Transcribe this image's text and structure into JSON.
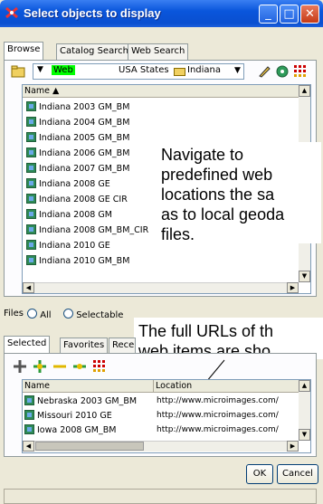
{
  "window": {
    "title": "Select objects to display"
  },
  "tabs_top": [
    "Browse",
    "Catalog Search",
    "Web Search"
  ],
  "location_bar": {
    "web_label": "Web",
    "country": "USA States",
    "state": "Indiana"
  },
  "list_header": "Name ▲",
  "browse_items": [
    "Indiana 2003 GM_BM",
    "Indiana 2004 GM_BM",
    "Indiana 2005 GM_BM",
    "Indiana 2006 GM_BM",
    "Indiana 2007 GM_BM",
    "Indiana 2008 GE",
    "Indiana 2008 GE CIR",
    "Indiana 2008 GM",
    "Indiana 2008 GM_BM_CIR",
    "Indiana 2010 GE",
    "Indiana 2010 GM_BM"
  ],
  "annotation1": [
    "Navigate to",
    "predefined web",
    "locations the sa",
    "as to local geoda",
    "files."
  ],
  "annotation2": [
    "The full URLs of th",
    "web items are sho"
  ],
  "files_row": {
    "label": "Files",
    "all": "All",
    "selectable": "Selectable"
  },
  "tabs_bottom": [
    "Selected",
    "Favorites",
    "Recent"
  ],
  "selected_headers": {
    "name": "Name",
    "location": "Location"
  },
  "selected_items": [
    {
      "name": "Nebraska 2003 GM_BM",
      "location": "http://www.microimages.com/"
    },
    {
      "name": "Missouri 2010 GE",
      "location": "http://www.microimages.com/"
    },
    {
      "name": "Iowa 2008 GM_BM",
      "location": "http://www.microimages.com/"
    }
  ],
  "buttons": {
    "ok": "OK",
    "cancel": "Cancel"
  },
  "colors": {
    "title_bar": "#0a56dc",
    "web_highlight": "#00ff00"
  }
}
